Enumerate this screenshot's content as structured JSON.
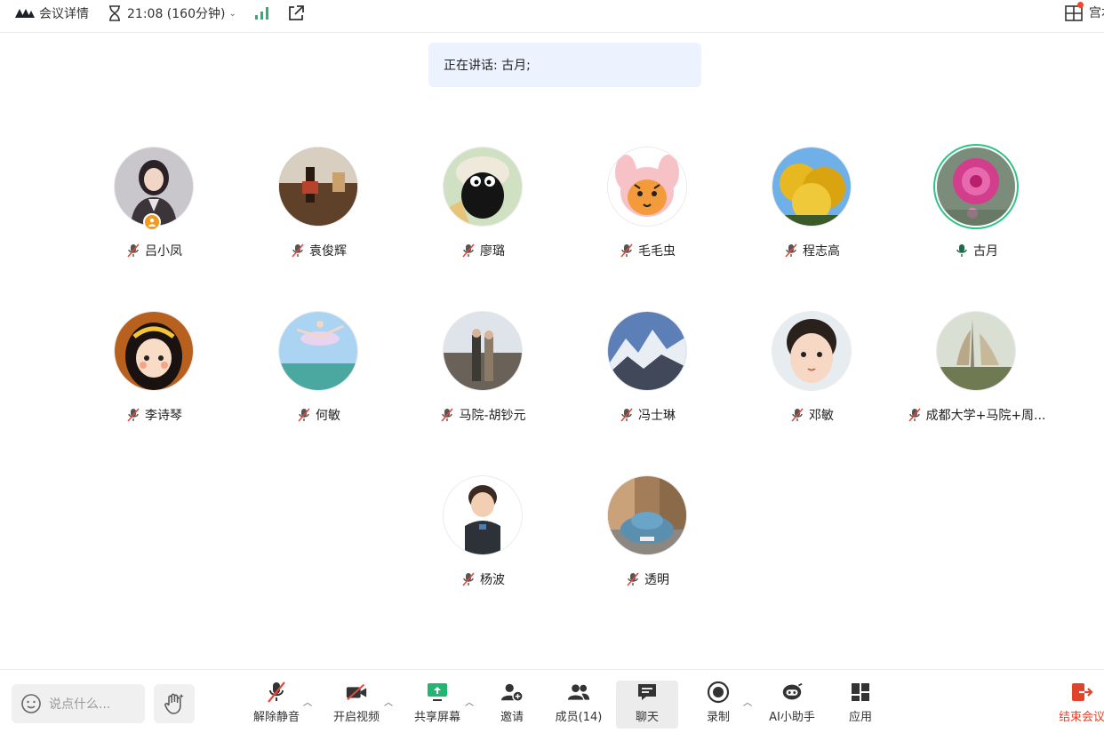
{
  "topbar": {
    "meeting_info": "会议详情",
    "timer": "21:08 (160分钟)",
    "user_short": "宫本"
  },
  "banner": {
    "speaking": "正在讲话: 古月;"
  },
  "participants": [
    {
      "name": "吕小凤",
      "muted": true,
      "host": true
    },
    {
      "name": "袁俊辉",
      "muted": true
    },
    {
      "name": "廖璐",
      "muted": true
    },
    {
      "name": "毛毛虫",
      "muted": true
    },
    {
      "name": "程志高",
      "muted": true
    },
    {
      "name": "古月",
      "muted": false,
      "speaking": true
    },
    {
      "name": "李诗琴",
      "muted": true
    },
    {
      "name": "何敏",
      "muted": true
    },
    {
      "name": "马院-胡钞元",
      "muted": true
    },
    {
      "name": "冯士琳",
      "muted": true
    },
    {
      "name": "邓敏",
      "muted": true
    },
    {
      "name": "成都大学+马院+周...",
      "muted": true
    },
    {
      "name": "杨波",
      "muted": true
    },
    {
      "name": "透明",
      "muted": true
    }
  ],
  "toolbar": {
    "chat_placeholder": "说点什么...",
    "unmute": "解除静音",
    "start_video": "开启视频",
    "share_screen": "共享屏幕",
    "invite": "邀请",
    "members": "成员(14)",
    "chat": "聊天",
    "record": "录制",
    "ai_assistant": "AI小助手",
    "apps": "应用",
    "end_meeting": "结束会议"
  },
  "colors": {
    "accent_green": "#2fc38a",
    "end_red": "#e0432a",
    "banner_bg": "#ecf2fe"
  }
}
